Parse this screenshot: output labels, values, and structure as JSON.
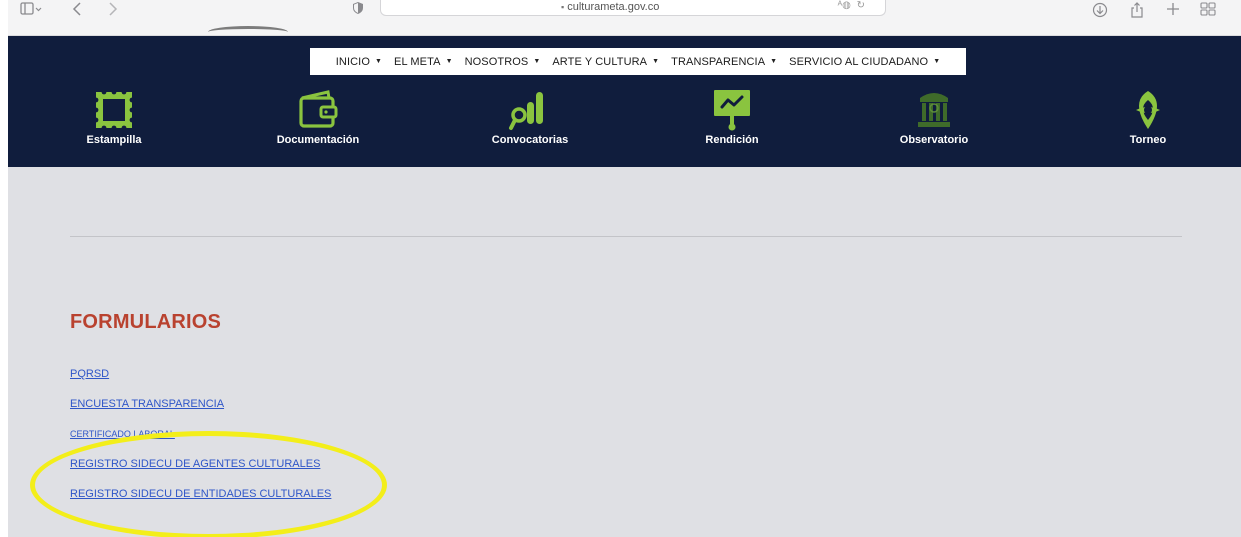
{
  "browser": {
    "url": "culturameta.gov.co",
    "sidebar_icon": "sidebar-icon",
    "back_icon": "back-icon",
    "forward_icon": "forward-icon",
    "shield_icon": "shield-icon",
    "translate_icon": "translate-icon",
    "reload_icon": "reload-icon",
    "download_icon": "download-icon",
    "share_icon": "share-icon",
    "new_tab_icon": "plus-icon",
    "tabs_icon": "tab-overview-icon"
  },
  "nav": {
    "items": [
      {
        "label": "INICIO"
      },
      {
        "label": "EL META"
      },
      {
        "label": "NOSOTROS"
      },
      {
        "label": "ARTE Y CULTURA"
      },
      {
        "label": "TRANSPARENCIA"
      },
      {
        "label": "SERVICIO AL CIUDADANO"
      }
    ]
  },
  "quick_links": [
    {
      "label": "Estampilla",
      "icon": "stamp-icon"
    },
    {
      "label": "Documentación",
      "icon": "wallet-icon"
    },
    {
      "label": "Convocatorias",
      "icon": "search-chart-icon"
    },
    {
      "label": "Rendición",
      "icon": "presentation-icon"
    },
    {
      "label": "Observatorio",
      "icon": "building-icon"
    },
    {
      "label": "Torneo",
      "icon": "torneo-logo-icon"
    }
  ],
  "content": {
    "title": "FORMULARIOS",
    "links": [
      {
        "label": "PQRSD"
      },
      {
        "label": "ENCUESTA TRANSPARENCIA"
      },
      {
        "label": "CERTIFICADO LABORAL"
      },
      {
        "label": "REGISTRO SIDECU DE AGENTES CULTURALES"
      },
      {
        "label": "REGISTRO SIDECU DE ENTIDADES CULTURALES"
      }
    ]
  },
  "colors": {
    "header_bg": "#101d3d",
    "icon_green": "#8ac43f",
    "title_red": "#b9422f",
    "link_blue": "#2f56c8",
    "highlight_yellow": "#f3ee1a",
    "content_bg": "#dfe0e4"
  }
}
